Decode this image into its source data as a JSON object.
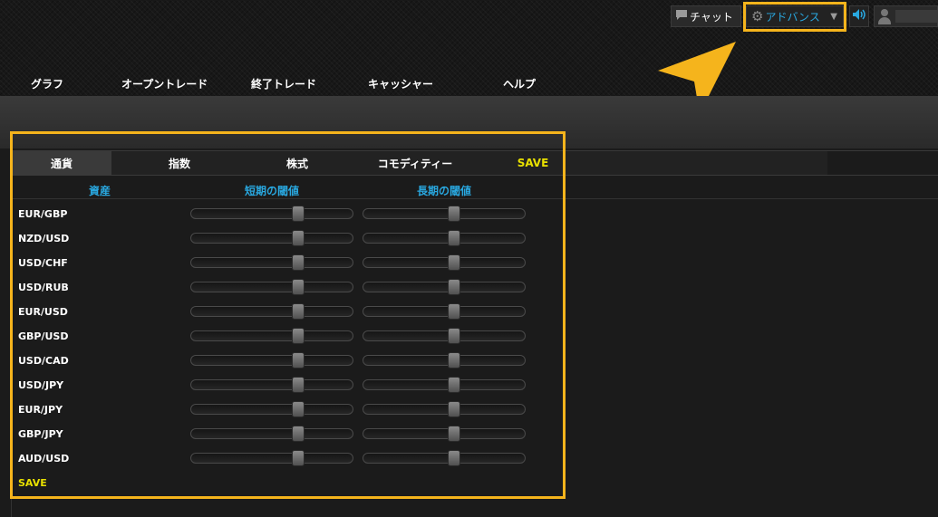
{
  "topbar": {
    "chat_label": "チャット",
    "advanced_label": "アドバンス",
    "icons": {
      "chat": "chat-bubble-icon",
      "gear": "gear-icon",
      "caret": "caret-down-icon",
      "sound": "speaker-icon",
      "user": "user-avatar-icon"
    }
  },
  "nav": {
    "items": [
      "グラフ",
      "オープントレード",
      "終了トレード",
      "キャッシャー",
      "ヘルプ"
    ]
  },
  "tabs": {
    "items": [
      "通貨",
      "指数",
      "株式",
      "コモディティー"
    ],
    "active": "通貨",
    "save_label": "SAVE"
  },
  "table": {
    "headers": [
      "資産",
      "短期の閾値",
      "長期の閾値"
    ],
    "rows": [
      {
        "asset": "EUR/GBP",
        "short": 0.67,
        "long": 0.56
      },
      {
        "asset": "NZD/USD",
        "short": 0.67,
        "long": 0.56
      },
      {
        "asset": "USD/CHF",
        "short": 0.67,
        "long": 0.56
      },
      {
        "asset": "USD/RUB",
        "short": 0.67,
        "long": 0.56
      },
      {
        "asset": "EUR/USD",
        "short": 0.67,
        "long": 0.56
      },
      {
        "asset": "GBP/USD",
        "short": 0.67,
        "long": 0.56
      },
      {
        "asset": "USD/CAD",
        "short": 0.67,
        "long": 0.56
      },
      {
        "asset": "USD/JPY",
        "short": 0.67,
        "long": 0.56
      },
      {
        "asset": "EUR/JPY",
        "short": 0.67,
        "long": 0.56
      },
      {
        "asset": "GBP/JPY",
        "short": 0.67,
        "long": 0.56
      },
      {
        "asset": "AUD/USD",
        "short": 0.67,
        "long": 0.56
      }
    ],
    "bottom_save_label": "SAVE"
  },
  "colors": {
    "highlight": "#f5b41c",
    "accent_blue": "#29a8e0",
    "save_yellow": "#e8e000"
  }
}
